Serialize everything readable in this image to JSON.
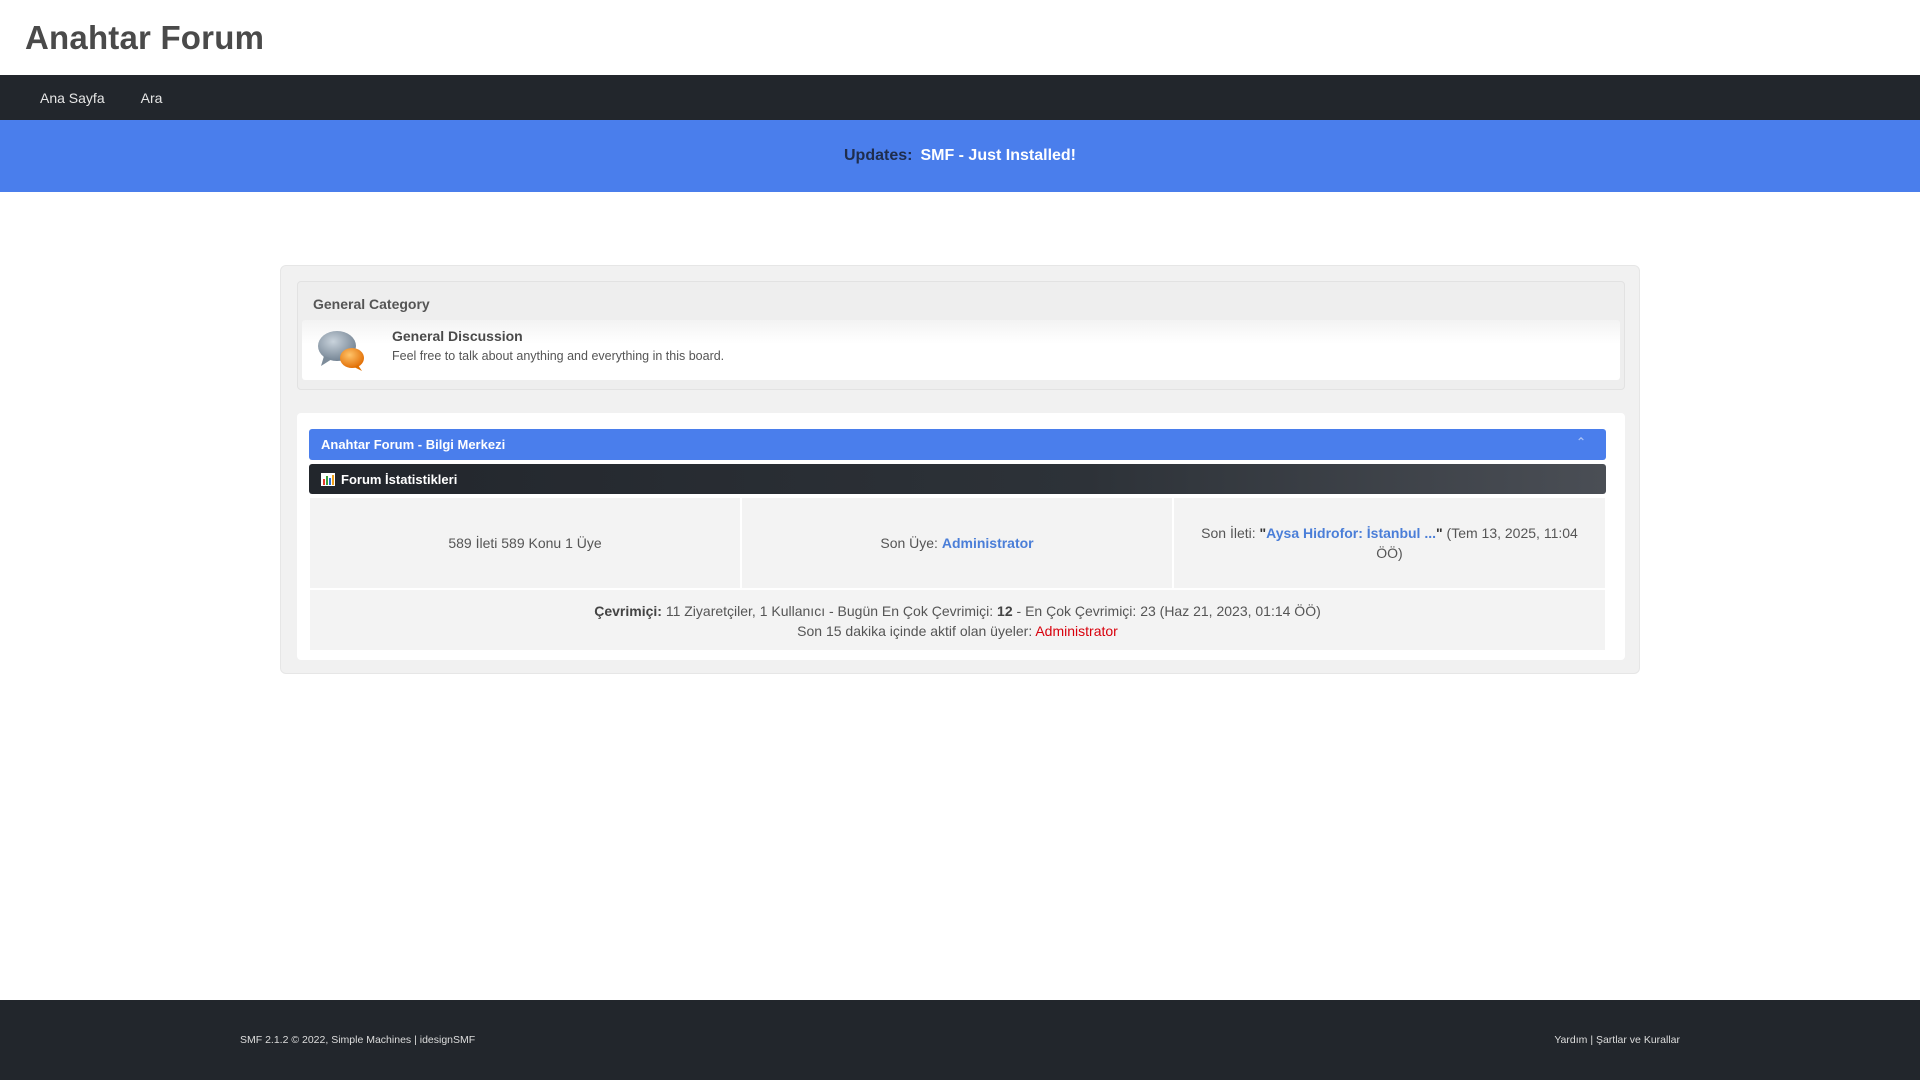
{
  "header": {
    "title": "Anahtar Forum"
  },
  "nav": {
    "items": [
      {
        "label": "Ana Sayfa"
      },
      {
        "label": "Ara"
      }
    ]
  },
  "updates": {
    "label": "Updates:",
    "text": "SMF - Just Installed!"
  },
  "category": {
    "title": "General Category",
    "board": {
      "name": "General Discussion",
      "description": "Feel free to talk about anything and everything in this board.",
      "icon": "chat-bubbles-icon"
    }
  },
  "info_center": {
    "title": "Anahtar Forum - Bilgi Merkezi",
    "toggle_icon": "collapse-icon",
    "stats_title": "Forum İstatistikleri",
    "stats_icon": "bar-chart-icon",
    "totals": "589 İleti 589 Konu 1 Üye",
    "latest_member_label": "Son Üye:",
    "latest_member": "Administrator",
    "latest_post_label": "Son İleti:",
    "latest_post_title": "Aysa Hidrofor: İstanbul ...",
    "latest_post_date": "(Tem 13, 2025, 11:04 ÖÖ)",
    "online_label": "Çevrimiçi:",
    "online_text": "11 Ziyaretçiler, 1 Kullanıcı",
    "most_today_text": " - Bugün En Çok Çevrimiçi:",
    "most_today_value": "12",
    "most_ever_text": " -  En Çok Çevrimiçi: 23 (Haz 21, 2023, 01:14 ÖÖ)",
    "active_users_label": "Son 15 dakika içinde aktif olan üyeler:",
    "active_user": "Administrator"
  },
  "footer": {
    "copyright": "SMF 2.1.2 © 2022,",
    "simple_machines": "Simple Machines",
    "idesign": "idesignSMF",
    "help": "Yardım",
    "terms": "Şartlar ve Kurallar",
    "separator": "|"
  },
  "colors": {
    "accent": "#4a7eec",
    "dark": "#22262c",
    "link": "#4a7ed8",
    "admin": "#d8000c"
  }
}
